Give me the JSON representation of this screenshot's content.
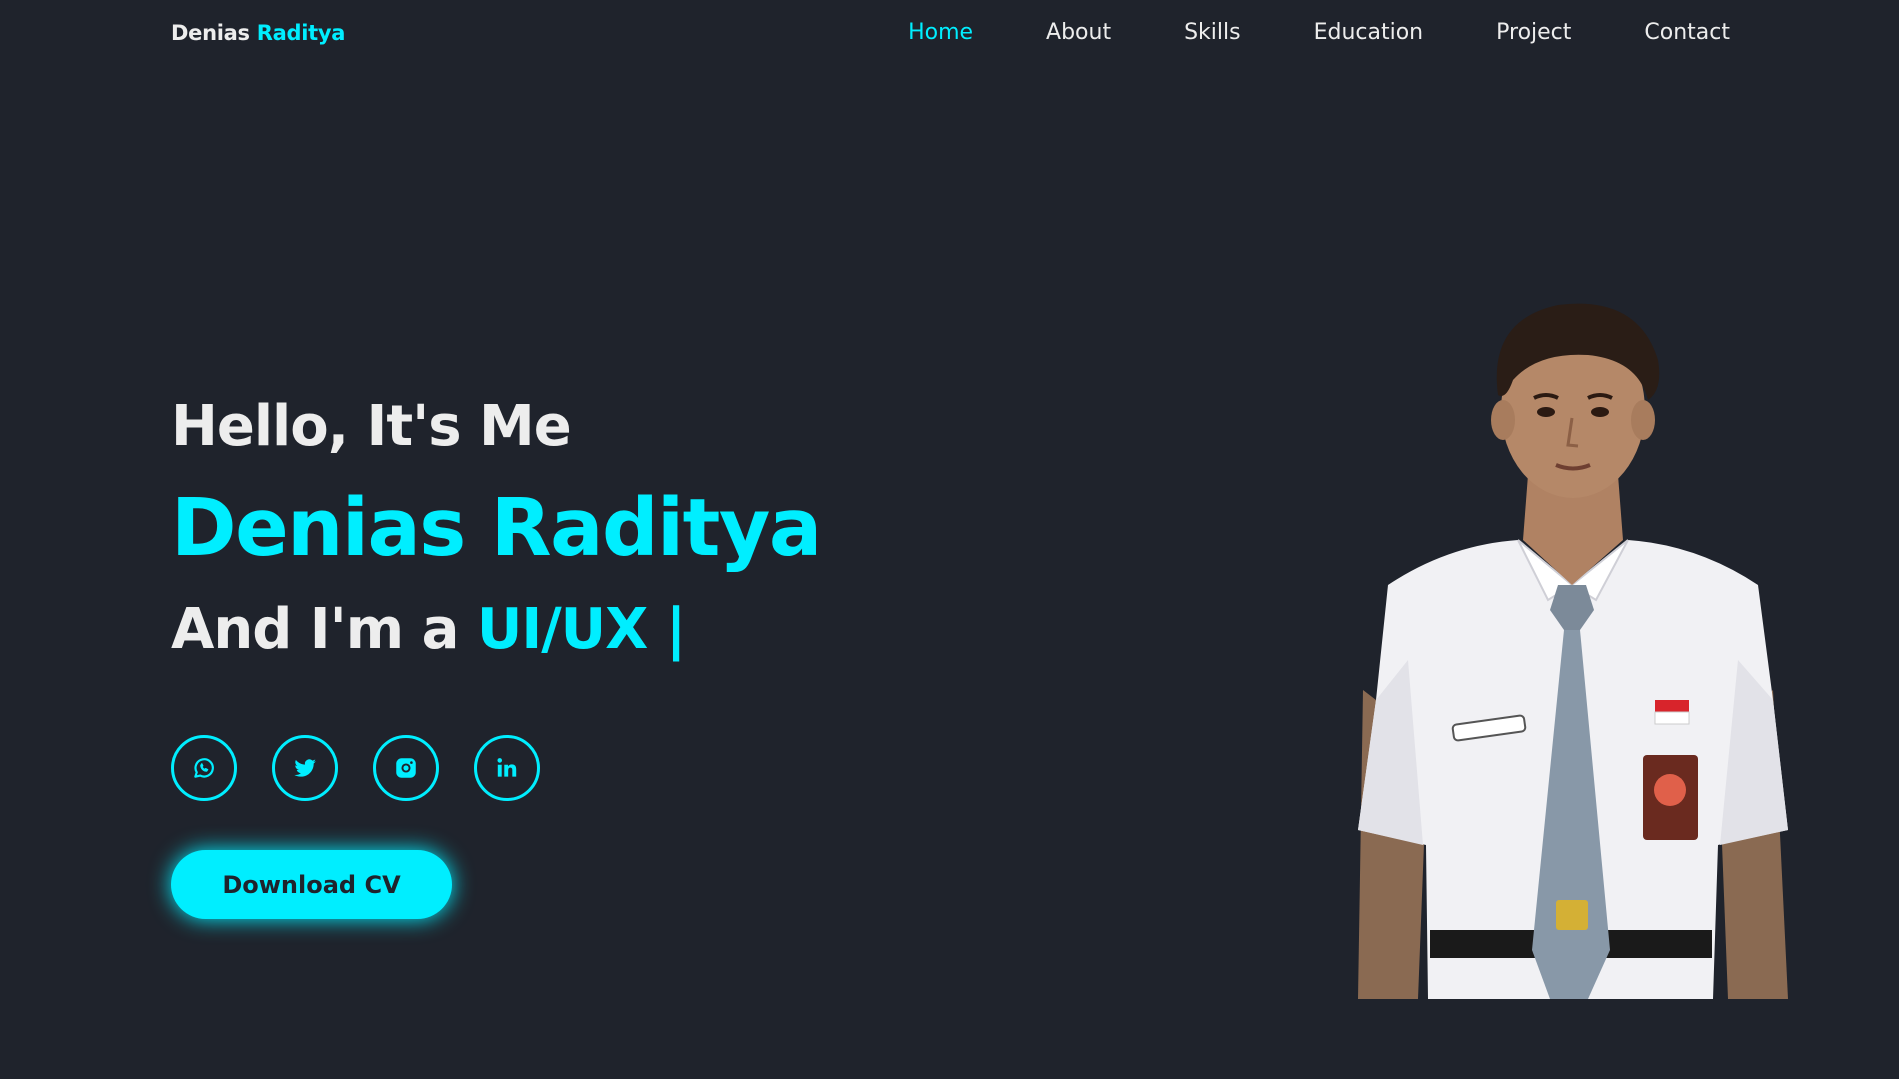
{
  "logo": {
    "first": "Denias",
    "second": "Raditya"
  },
  "nav": {
    "items": [
      "Home",
      "About",
      "Skills",
      "Education",
      "Project",
      "Contact"
    ],
    "active": "Home"
  },
  "hero": {
    "greeting": "Hello, It's Me",
    "name": "Denias Raditya",
    "role_prefix": "And I'm a",
    "role_typed": "UI/UX |"
  },
  "socials": [
    "whatsapp-icon",
    "twitter-icon",
    "instagram-icon",
    "linkedin-icon"
  ],
  "cta": {
    "label": "Download CV"
  },
  "colors": {
    "background": "#1f232c",
    "accent": "#00eeff",
    "text": "#ededed"
  }
}
